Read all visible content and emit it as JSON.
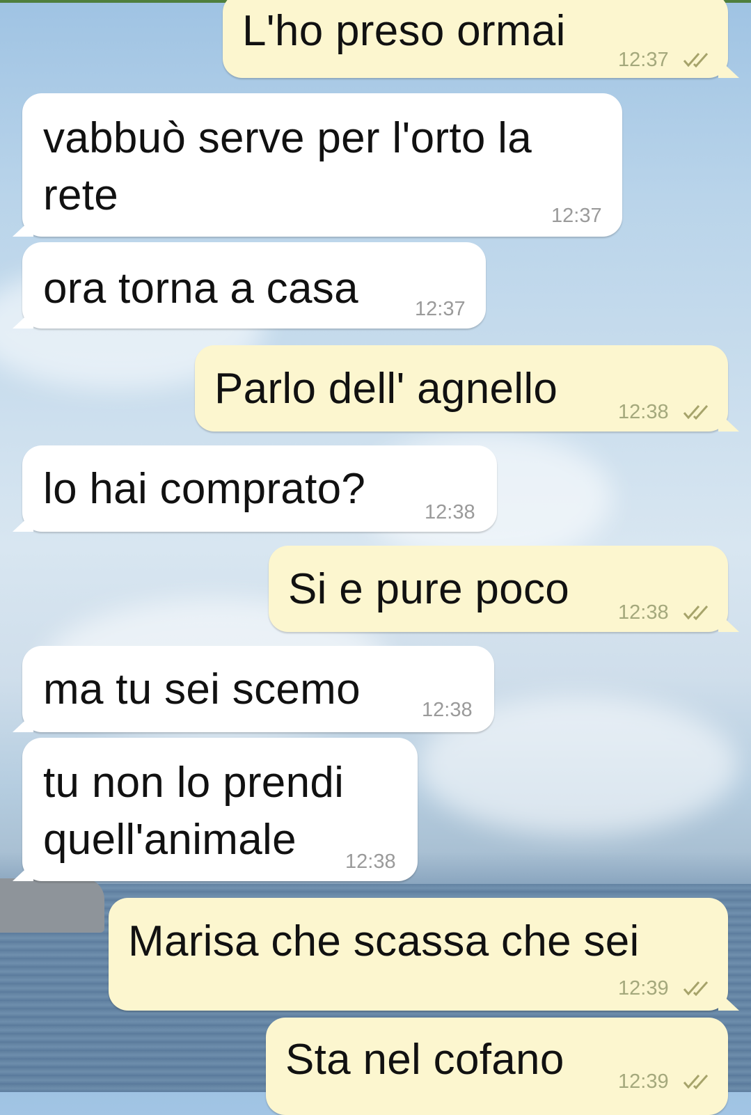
{
  "messages": [
    {
      "text": "L'ho preso ormai",
      "time": "12:37",
      "direction": "out",
      "read": true
    },
    {
      "text1": "vabbuò serve per l'orto la",
      "text2": "rete",
      "time": "12:37",
      "direction": "in"
    },
    {
      "text": "ora torna a casa",
      "time": "12:37",
      "direction": "in"
    },
    {
      "text": "Parlo dell' agnello",
      "time": "12:38",
      "direction": "out",
      "read": true
    },
    {
      "text": "lo hai comprato?",
      "time": "12:38",
      "direction": "in"
    },
    {
      "text": "Si e pure poco",
      "time": "12:38",
      "direction": "out",
      "read": true
    },
    {
      "text": "ma tu sei scemo",
      "time": "12:38",
      "direction": "in"
    },
    {
      "text1": "tu non lo prendi",
      "text2": "quell'animale",
      "time": "12:38",
      "direction": "in"
    },
    {
      "text": "Marisa che scassa che sei",
      "time": "12:39",
      "direction": "out",
      "read": true
    },
    {
      "text": "Sta nel cofano",
      "time": "12:39",
      "direction": "out",
      "read": true
    }
  ],
  "colors": {
    "incoming_bubble": "#ffffff",
    "outgoing_bubble": "#fcf6cf",
    "read_check": "#a6a36a"
  },
  "icons": {
    "read_receipt": "double-check-icon"
  }
}
